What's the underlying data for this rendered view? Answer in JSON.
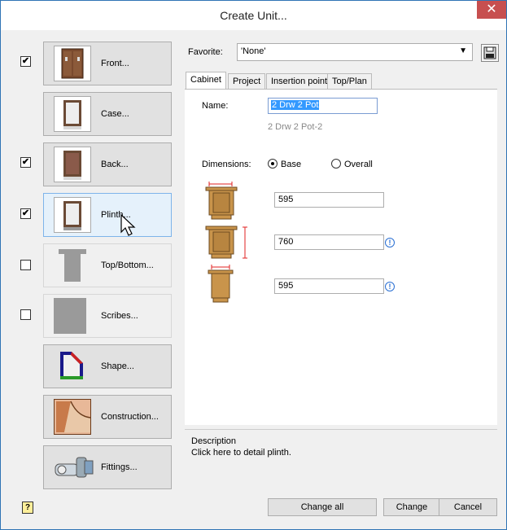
{
  "window": {
    "title": "Create Unit...",
    "close_glyph": "✕"
  },
  "nav": [
    {
      "label": "Front...",
      "checked": true,
      "has_checkbox": true,
      "icon": "cabinet-front-icon"
    },
    {
      "label": "Case...",
      "checked": false,
      "has_checkbox": false,
      "icon": "cabinet-case-icon"
    },
    {
      "label": "Back...",
      "checked": true,
      "has_checkbox": true,
      "icon": "cabinet-back-icon"
    },
    {
      "label": "Plinth...",
      "checked": true,
      "has_checkbox": true,
      "icon": "cabinet-plinth-icon",
      "active": true
    },
    {
      "label": "Top/Bottom...",
      "checked": false,
      "has_checkbox": true,
      "icon": "top-bottom-icon"
    },
    {
      "label": "Scribes...",
      "checked": false,
      "has_checkbox": true,
      "icon": "scribes-icon"
    },
    {
      "label": "Shape...",
      "checked": false,
      "has_checkbox": false,
      "icon": "shape-icon"
    },
    {
      "label": "Construction...",
      "checked": false,
      "has_checkbox": false,
      "icon": "construction-icon"
    },
    {
      "label": "Fittings...",
      "checked": false,
      "has_checkbox": false,
      "icon": "fittings-icon"
    }
  ],
  "favorite": {
    "label": "Favorite:",
    "value": "'None'"
  },
  "tabs": [
    "Cabinet",
    "Project",
    "Insertion point",
    "Top/Plan"
  ],
  "cabinet": {
    "name_label": "Name:",
    "name_value": "2 Drw 2 Pot",
    "name_sub": "2 Drw 2 Pot-2",
    "dimensions_label": "Dimensions:",
    "radio_base": "Base",
    "radio_overall": "Overall",
    "width": "595",
    "height": "760",
    "depth": "595"
  },
  "description": {
    "title": "Description",
    "text": "Click here to detail plinth."
  },
  "buttons": {
    "change_all": "Change all",
    "change": "Change",
    "cancel": "Cancel",
    "help": "?"
  },
  "colors": {
    "accent": "#2f74b5",
    "close": "#c74f4f",
    "selection": "#3399ff",
    "wood": "#c9944b",
    "dim_line": "#e02020"
  }
}
